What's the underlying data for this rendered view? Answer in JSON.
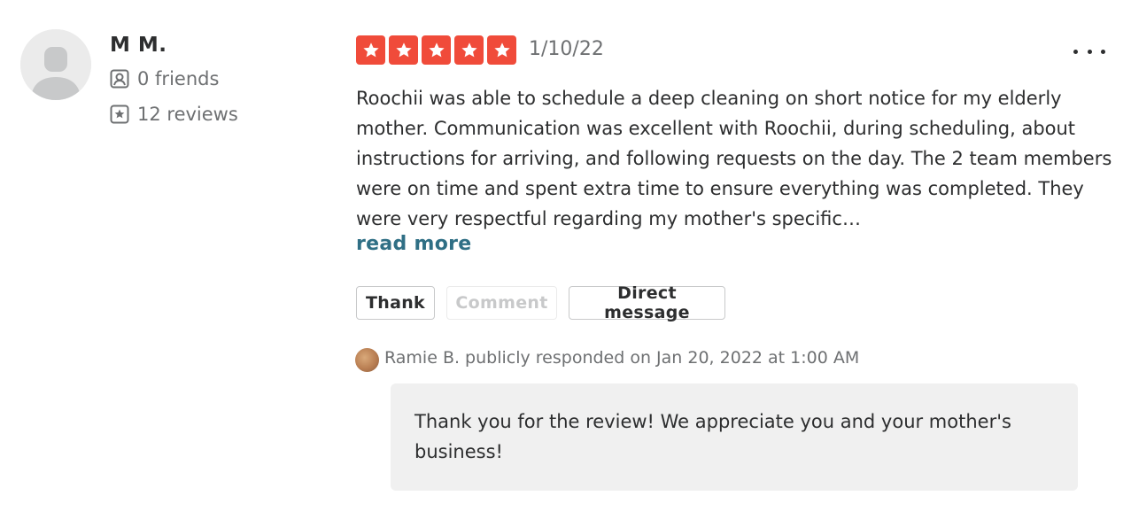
{
  "reviewer": {
    "name": "M M.",
    "friends": "0 friends",
    "reviews": "12 reviews"
  },
  "review": {
    "rating": 5,
    "date": "1/10/22",
    "text": "Roochii was able to schedule a deep cleaning on short notice for my elderly mother. Communication was excellent with Roochii, during scheduling, about instructions for arriving, and following requests on the day. The 2 team members were on time and spent extra time to ensure everything was completed. They were very respectful regarding my mother's specific…",
    "read_more": "read more",
    "star_color": "#f04b3a"
  },
  "actions": {
    "thank": "Thank",
    "comment": "Comment",
    "direct_message": "Direct message"
  },
  "response": {
    "header": "Ramie B. publicly responded on Jan 20, 2022 at 1:00 AM",
    "text": "Thank you for the review! We appreciate you and your mother's business!"
  },
  "icons": {
    "friends": "friends-icon",
    "reviews": "review-star-icon",
    "menu": "more-options-icon",
    "star": "star-icon"
  }
}
